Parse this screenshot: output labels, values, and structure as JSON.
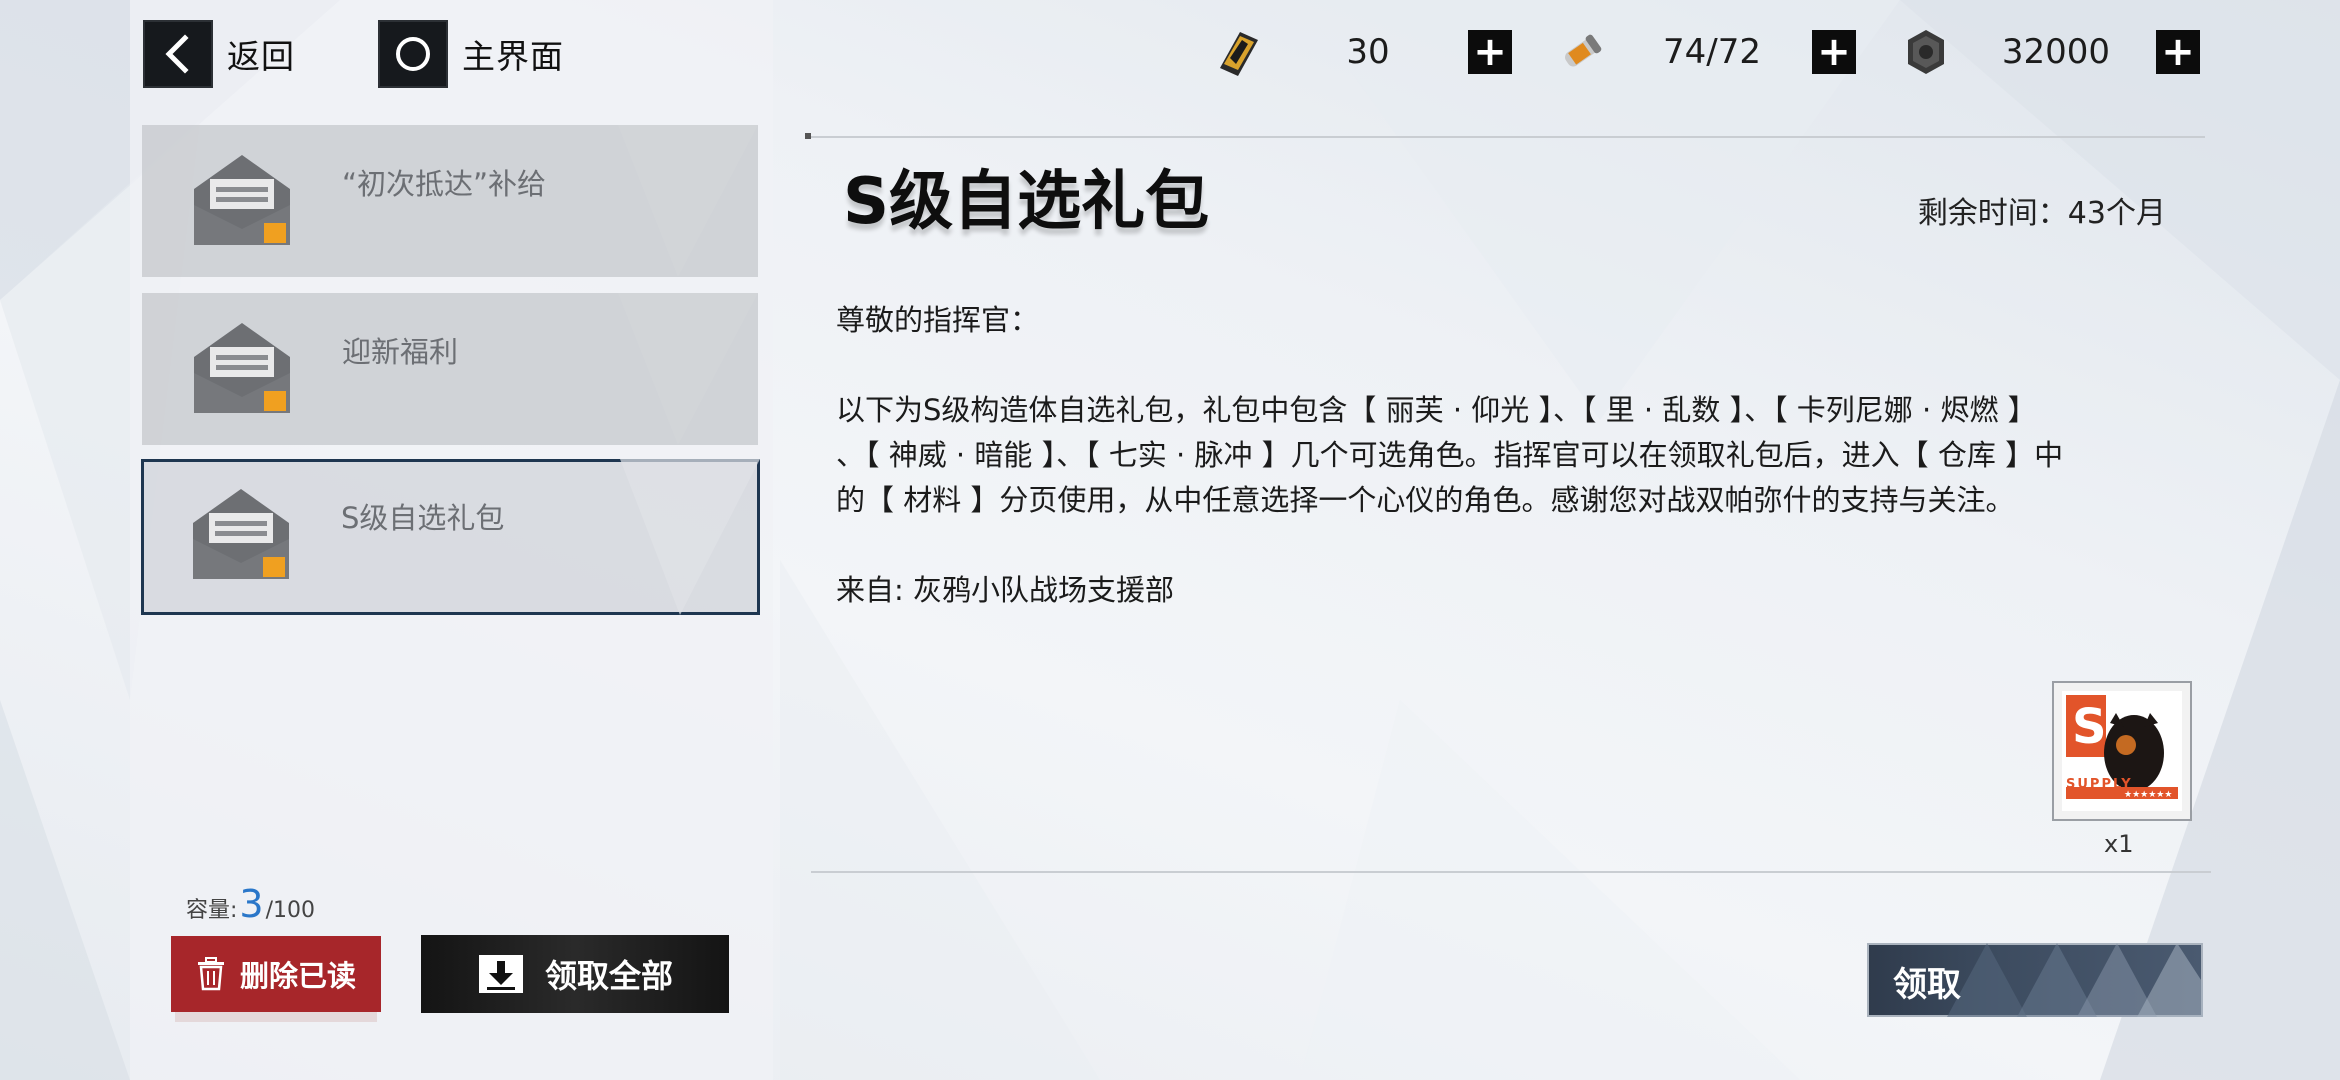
{
  "nav": {
    "back_label": "返回",
    "home_label": "主界面"
  },
  "resources": [
    {
      "name": "blackcard",
      "value": "30"
    },
    {
      "name": "serum",
      "value": "74/72"
    },
    {
      "name": "cog-coin",
      "value": "32000"
    }
  ],
  "mail_list": [
    {
      "title": "“初次抵达”补给",
      "selected": false
    },
    {
      "title": "迎新福利",
      "selected": false
    },
    {
      "title": "S级自选礼包",
      "selected": true
    }
  ],
  "capacity": {
    "label": "容量:",
    "current": "3",
    "max": "/100"
  },
  "buttons": {
    "delete_read": "删除已读",
    "claim_all": "领取全部",
    "claim": "领取"
  },
  "detail": {
    "title": "S级自选礼包",
    "remaining": "剩余时间：43个月",
    "greeting": "尊敬的指挥官：",
    "body_line1": "以下为S级构造体自选礼包，礼包中包含【 丽芙 · 仰光 】、【 里 · 乱数 】、【 卡列尼娜 · 烬燃 】",
    "body_line2": "、【 神威 · 暗能 】、【 七实 · 脉冲 】几个可选角色。指挥官可以在领取礼包后，进入【 仓库 】中",
    "body_line3": "的【 材料 】分页使用，从中任意选择一个心仪的角色。感谢您对战双帕弥什的支持与关注。",
    "sender": "来自: 灰鸦小队战场支援部",
    "reward_badge": "SUPPLY",
    "reward_count": "x1"
  },
  "colors": {
    "accent_blue": "#2a77c9",
    "delete_red": "#a7262a",
    "selected_border": "#1e3650"
  }
}
